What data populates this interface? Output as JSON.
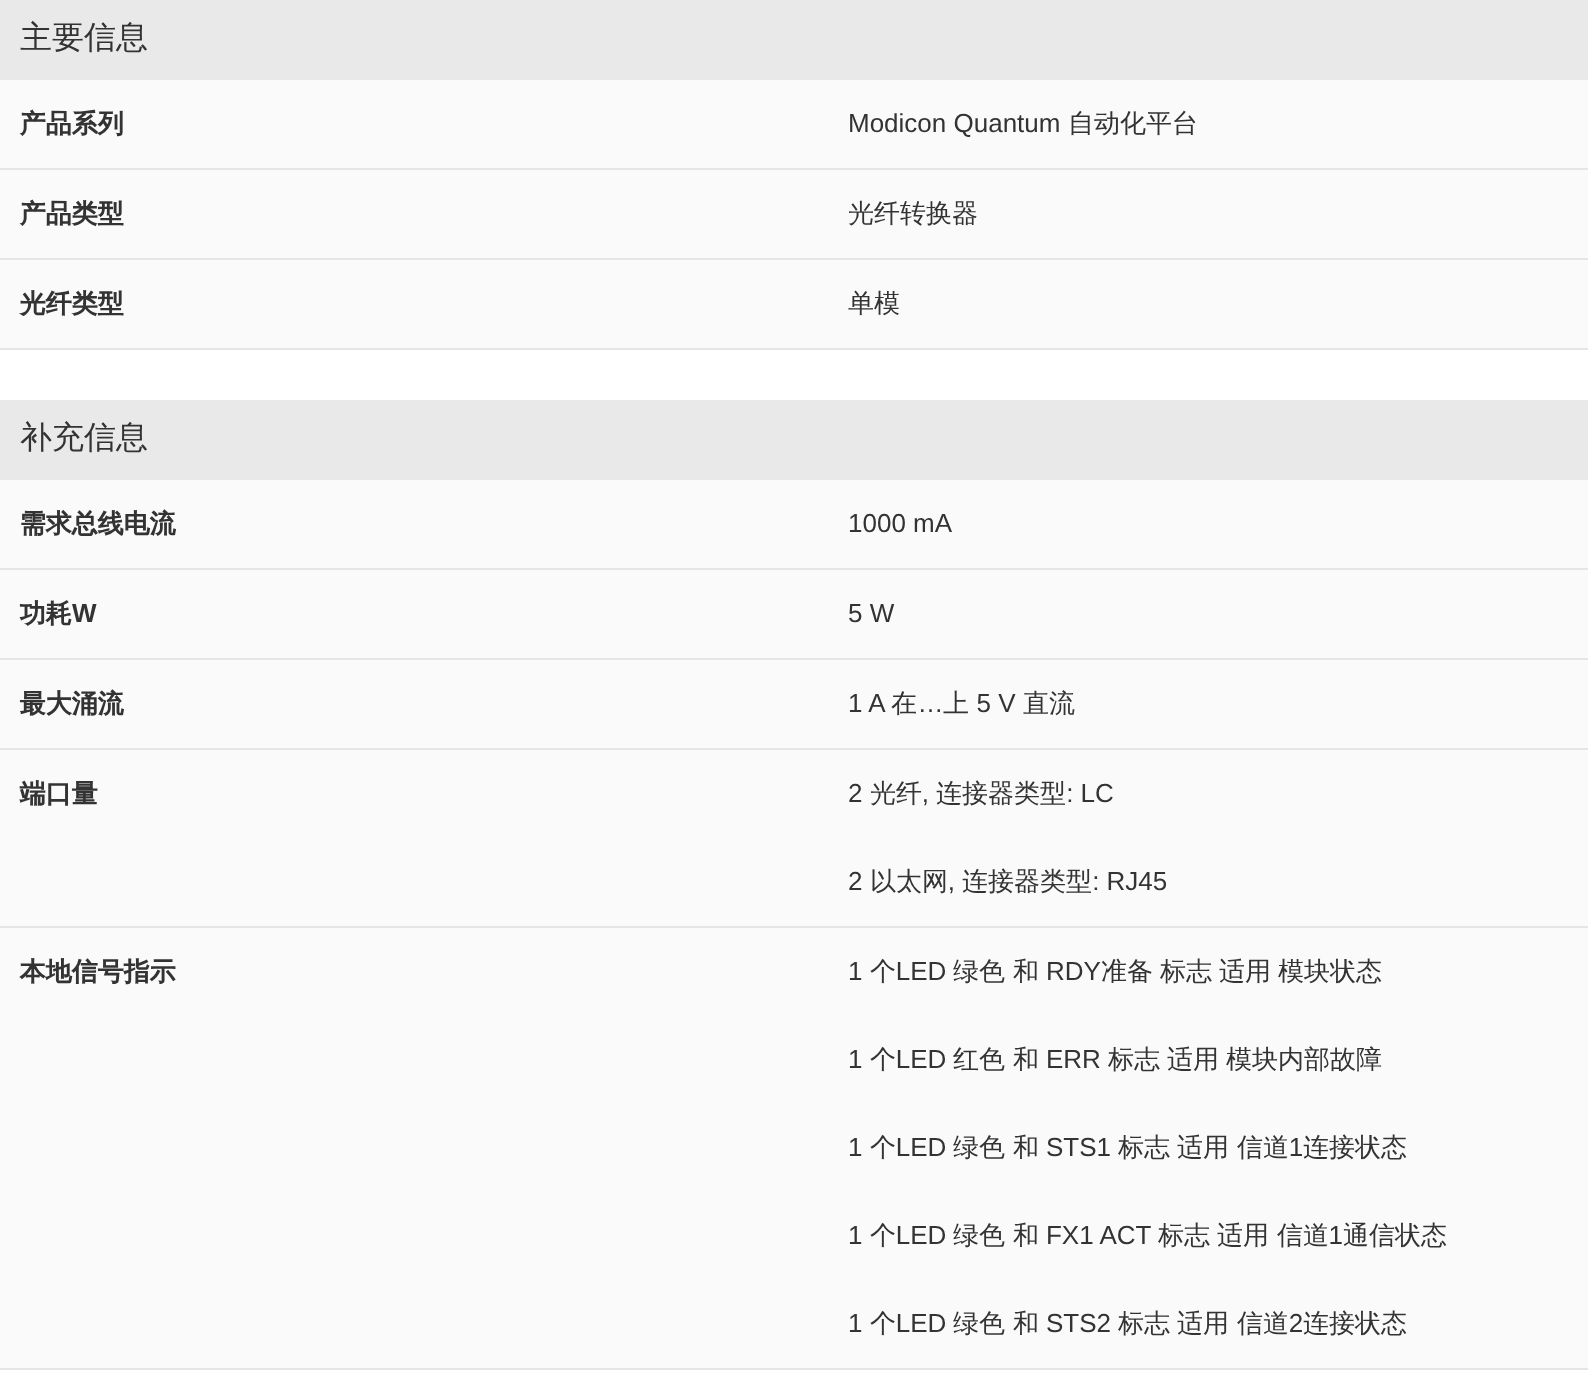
{
  "sections": [
    {
      "title": "主要信息",
      "rows": [
        {
          "label": "产品系列",
          "values": [
            "Modicon Quantum 自动化平台"
          ]
        },
        {
          "label": "产品类型",
          "values": [
            "光纤转换器"
          ]
        },
        {
          "label": "光纤类型",
          "values": [
            "单模"
          ]
        }
      ]
    },
    {
      "title": "补充信息",
      "rows": [
        {
          "label": "需求总线电流",
          "values": [
            "1000 mA"
          ]
        },
        {
          "label": "功耗W",
          "values": [
            "5 W"
          ]
        },
        {
          "label": "最大涌流",
          "values": [
            "1 A 在…上 5 V 直流"
          ]
        },
        {
          "label": "端口量",
          "values": [
            "2 光纤, 连接器类型: LC",
            "2 以太网, 连接器类型: RJ45"
          ]
        },
        {
          "label": "本地信号指示",
          "values": [
            "1 个LED 绿色 和 RDY准备 标志 适用 模块状态",
            "1 个LED 红色 和 ERR 标志 适用 模块内部故障",
            "1 个LED 绿色 和 STS1 标志 适用 信道1连接状态",
            "1 个LED 绿色 和 FX1 ACT 标志 适用 信道1通信状态",
            "1 个LED 绿色 和 STS2 标志 适用 信道2连接状态"
          ]
        }
      ]
    }
  ]
}
